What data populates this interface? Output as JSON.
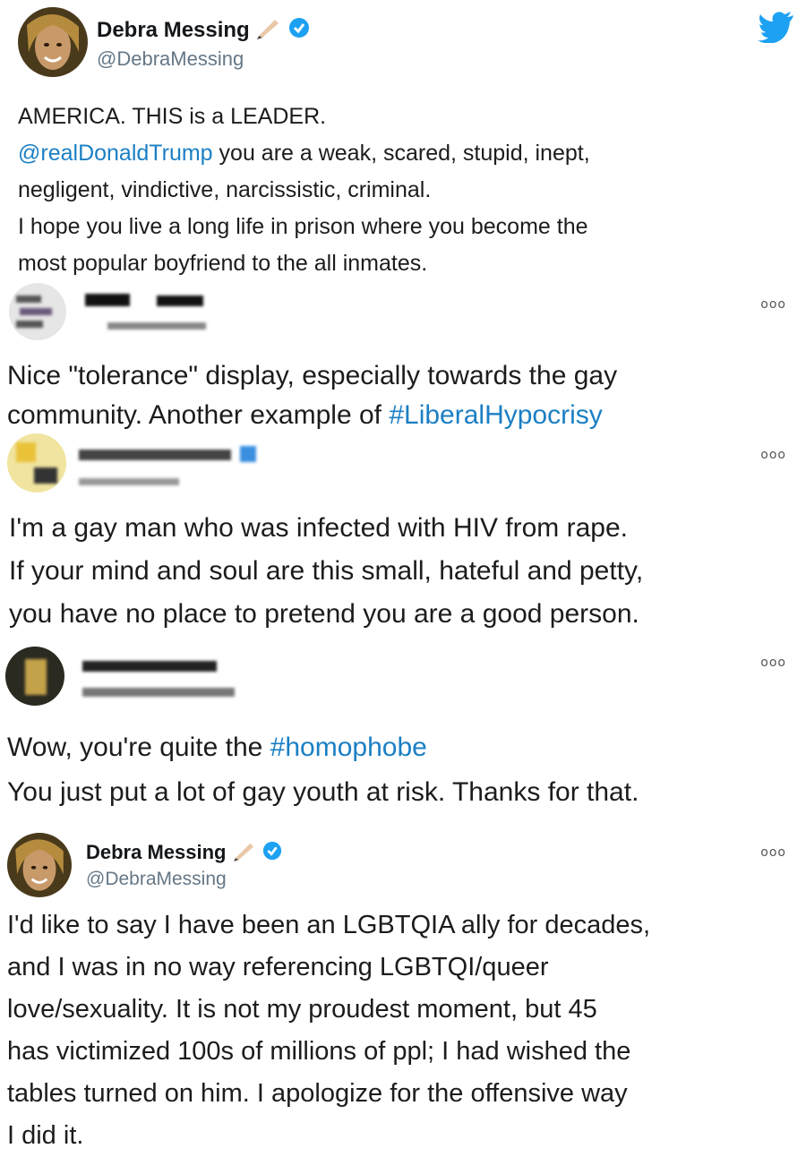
{
  "tweet1": {
    "name": "Debra Messing",
    "handle": "@DebraMessing",
    "lines": [
      {
        "parts": [
          {
            "t": "AMERICA.   THIS is a LEADER.",
            "link": false
          }
        ]
      },
      {
        "parts": [
          {
            "t": "@realDonaldTrump",
            "link": true
          },
          {
            "t": " you are a weak, scared, stupid, inept,",
            "link": false
          }
        ]
      },
      {
        "parts": [
          {
            "t": "negligent, vindictive, narcissistic, criminal.",
            "link": false
          }
        ]
      },
      {
        "parts": [
          {
            "t": "I hope you live a long life in prison where you become the",
            "link": false
          }
        ]
      },
      {
        "parts": [
          {
            "t": "most popular boyfriend to the all inmates.",
            "link": false
          }
        ]
      }
    ]
  },
  "reply1": {
    "lines": [
      {
        "parts": [
          {
            "t": "Nice \"tolerance\" display, especially towards the gay",
            "link": false
          }
        ]
      },
      {
        "parts": [
          {
            "t": "community. Another example of ",
            "link": false
          },
          {
            "t": "#LiberalHypocrisy",
            "link": true
          }
        ]
      }
    ]
  },
  "reply2": {
    "lines": [
      {
        "parts": [
          {
            "t": "I'm a gay man who was infected with HIV from rape.",
            "link": false
          }
        ]
      },
      {
        "parts": [
          {
            "t": "If your mind and soul are this small, hateful and petty,",
            "link": false
          }
        ]
      },
      {
        "parts": [
          {
            "t": "you have no place to pretend you are a good person.",
            "link": false
          }
        ]
      }
    ]
  },
  "reply3": {
    "lines": [
      {
        "parts": [
          {
            "t": "Wow, you're quite the ",
            "link": false
          },
          {
            "t": "#homophobe",
            "link": true
          }
        ]
      },
      {
        "parts": [
          {
            "t": "You just put a lot of gay youth at risk. Thanks for that.",
            "link": false
          }
        ]
      }
    ]
  },
  "tweet2": {
    "name": "Debra Messing",
    "handle": "@DebraMessing",
    "lines": [
      {
        "parts": [
          {
            "t": "I'd like to say I have been an LGBTQIA ally for decades,",
            "link": false
          }
        ]
      },
      {
        "parts": [
          {
            "t": "and I was in no way referencing LGBTQI/queer",
            "link": false
          }
        ]
      },
      {
        "parts": [
          {
            "t": "love/sexuality. It is not my proudest moment, but 45",
            "link": false
          }
        ]
      },
      {
        "parts": [
          {
            "t": "has victimized 100s of millions of ppl;  I had wished the",
            "link": false
          }
        ]
      },
      {
        "parts": [
          {
            "t": "tables turned on him.  I apologize for the offensive way",
            "link": false
          }
        ]
      },
      {
        "parts": [
          {
            "t": "I did it.",
            "link": false
          }
        ]
      }
    ]
  },
  "more_glyph": "ooo",
  "colors": {
    "link": "#1b7fc4",
    "verified": "#1da1f2",
    "twitter": "#1da1f2"
  },
  "icons": [
    "twitter-bird-icon",
    "verified-badge-icon",
    "pen-emoji-icon",
    "more-options-icon"
  ]
}
